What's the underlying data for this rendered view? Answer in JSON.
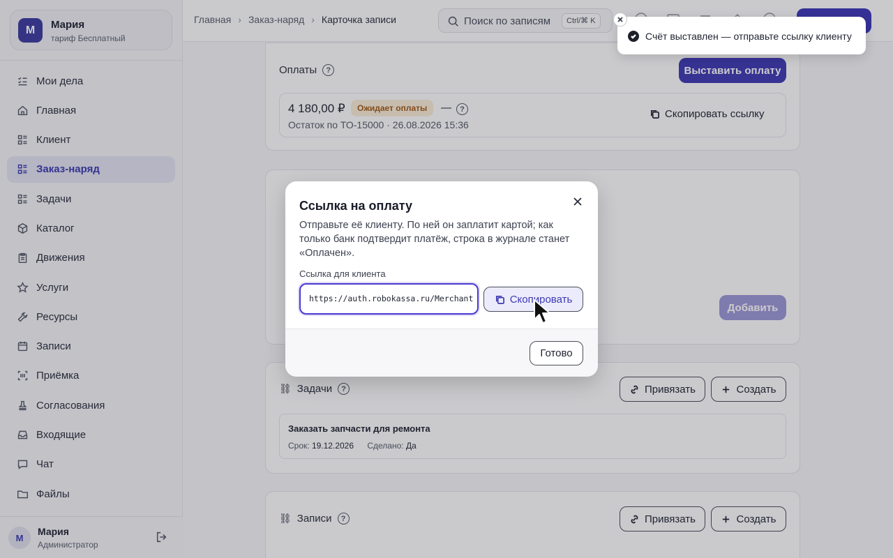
{
  "account": {
    "avatar_letter": "М",
    "name": "Мария",
    "plan": "тариф Бесплатный"
  },
  "sidebar": {
    "items": [
      {
        "label": "Мои дела",
        "icon": "checklist-icon"
      },
      {
        "label": "Главная",
        "icon": "home-icon"
      },
      {
        "label": "Клиент",
        "icon": "list-icon"
      },
      {
        "label": "Заказ-наряд",
        "icon": "list-icon",
        "active": true
      },
      {
        "label": "Задачи",
        "icon": "list-icon"
      },
      {
        "label": "Каталог",
        "icon": "box-icon"
      },
      {
        "label": "Движения",
        "icon": "clipboard-icon"
      },
      {
        "label": "Услуги",
        "icon": "star-icon"
      },
      {
        "label": "Ресурсы",
        "icon": "wrench-icon"
      },
      {
        "label": "Записи",
        "icon": "calendar-icon"
      },
      {
        "label": "Приёмка",
        "icon": "barcode-icon"
      },
      {
        "label": "Согласования",
        "icon": "stamp-icon"
      },
      {
        "label": "Входящие",
        "icon": "inbox-icon"
      },
      {
        "label": "Чат",
        "icon": "chat-icon"
      },
      {
        "label": "Файлы",
        "icon": "folder-icon"
      }
    ]
  },
  "user": {
    "avatar_letter": "М",
    "name": "Мария",
    "role": "Администратор"
  },
  "header": {
    "breadcrumbs": [
      "Главная",
      "Заказ-наряд",
      "Карточка записи"
    ],
    "search_placeholder": "Поиск по записям",
    "search_shortcut": "Ctrl/⌘ K"
  },
  "payments": {
    "title": "Оплаты",
    "issue_button": "Выставить оплату",
    "amount": "4 180,00 ₽",
    "status": "Ожидает оплаты",
    "dash": "—",
    "subtitle": "Остаток по ТО-15000 · 26.08.2026 15:36",
    "copy_link": "Скопировать ссылку"
  },
  "notes": {
    "add_button": "Добавить"
  },
  "tasks": {
    "title": "Задачи",
    "link_button": "Привязать",
    "create_button": "Создать",
    "item_title": "Заказать запчасти для ремонта",
    "due_label": "Срок:",
    "due_value": "19.12.2026",
    "done_label": "Сделано:",
    "done_value": "Да"
  },
  "records": {
    "title": "Записи",
    "link_button": "Привязать",
    "create_button": "Создать"
  },
  "modal": {
    "title": "Ссылка на оплату",
    "description": "Отправьте её клиенту. По ней он заплатит картой; как только банк подтвердит платёж, строка в журнале станет «Оплачен».",
    "field_label": "Ссылка для клиента",
    "url_value": "https://auth.robokassa.ru/Merchant",
    "copy_button": "Скопировать",
    "done_button": "Готово"
  },
  "toast": {
    "message": "Счёт выставлен — отправьте ссылку клиенту"
  },
  "colors": {
    "accent": "#3d39b3",
    "status_warning_bg": "#fbeed8",
    "status_warning_fg": "#a05a13"
  }
}
